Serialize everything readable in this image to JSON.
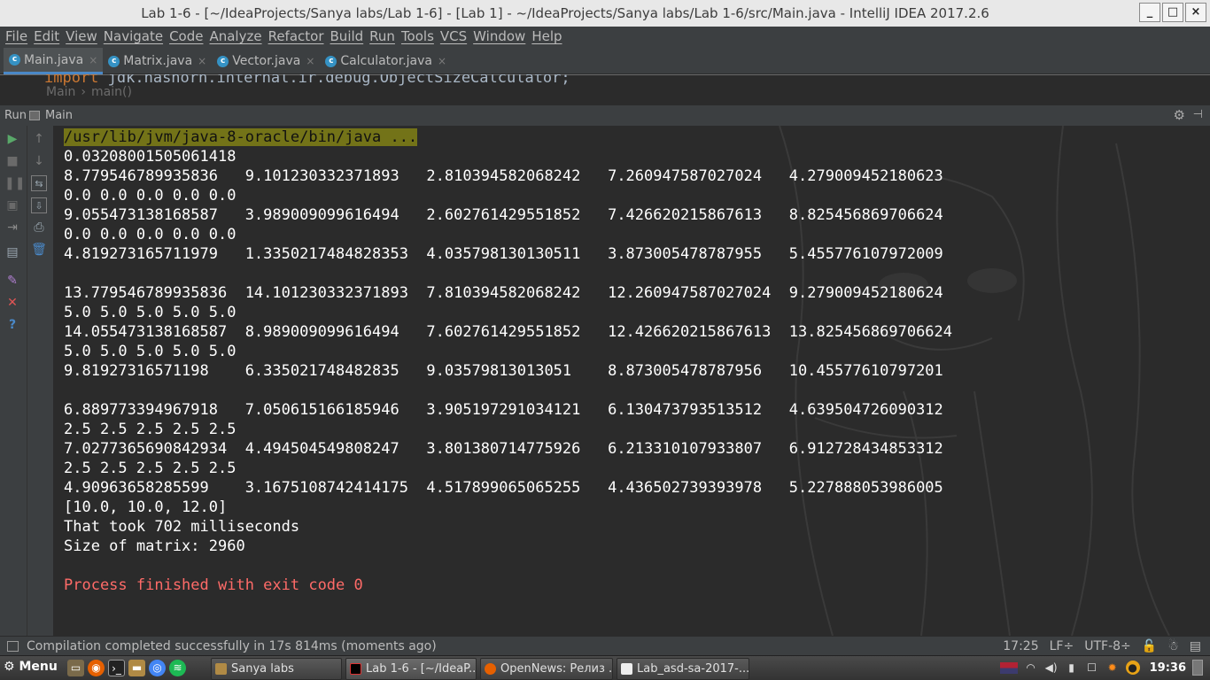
{
  "window": {
    "title": "Lab 1-6 - [~/IdeaProjects/Sanya labs/Lab 1-6] - [Lab 1] - ~/IdeaProjects/Sanya labs/Lab 1-6/src/Main.java - IntelliJ IDEA 2017.2.6",
    "minimize": "_",
    "maximize": "□",
    "close": "×"
  },
  "menu": [
    "File",
    "Edit",
    "View",
    "Navigate",
    "Code",
    "Analyze",
    "Refactor",
    "Build",
    "Run",
    "Tools",
    "VCS",
    "Window",
    "Help"
  ],
  "tabs": [
    {
      "label": "Main.java",
      "close": "×",
      "active": true
    },
    {
      "label": "Matrix.java",
      "close": "×",
      "active": false
    },
    {
      "label": "Vector.java",
      "close": "×",
      "active": false
    },
    {
      "label": "Calculator.java",
      "close": "×",
      "active": false
    }
  ],
  "editor": {
    "code_keyword": "import ",
    "code_package": "jdk.nashorn.internal.ir.debug.ObjectSizeCalculator;",
    "breadcrumb": [
      "Main",
      "main()"
    ]
  },
  "run_panel": {
    "label": "Run",
    "config": "Main"
  },
  "console": {
    "command": "/usr/lib/jvm/java-8-oracle/bin/java ...",
    "lines": [
      "0.03208001505061418",
      "8.779546789935836   9.101230332371893   2.810394582068242   7.260947587027024   4.279009452180623",
      "0.0 0.0 0.0 0.0 0.0",
      "9.055473138168587   3.989009099616494   2.602761429551852   7.426620215867613   8.825456869706624",
      "0.0 0.0 0.0 0.0 0.0",
      "4.819273165711979   1.3350217484828353  4.035798130130511   3.873005478787955   5.455776107972009",
      "",
      "13.779546789935836  14.101230332371893  7.810394582068242   12.260947587027024  9.279009452180624",
      "5.0 5.0 5.0 5.0 5.0",
      "14.055473138168587  8.989009099616494   7.602761429551852   12.426620215867613  13.825456869706624",
      "5.0 5.0 5.0 5.0 5.0",
      "9.81927316571198    6.335021748482835   9.03579813013051    8.873005478787956   10.45577610797201",
      "",
      "6.889773394967918   7.050615166185946   3.905197291034121   6.130473793513512   4.639504726090312",
      "2.5 2.5 2.5 2.5 2.5",
      "7.0277365690842934  4.494504549808247   3.801380714775926   6.213310107933807   6.912728434853312",
      "2.5 2.5 2.5 2.5 2.5",
      "4.90963658285599    3.1675108742414175  4.517899065065255   4.436502739393978   5.227888053986005",
      "[10.0, 10.0, 12.0]",
      "That took 702 milliseconds",
      "Size of matrix: 2960",
      ""
    ],
    "exit": "Process finished with exit code 0"
  },
  "status": {
    "message": "Compilation completed successfully in 17s 814ms (moments ago)",
    "position": "17:25",
    "line_sep": "LF÷",
    "encoding": "UTF-8÷"
  },
  "taskbar": {
    "start": "Menu",
    "windows": [
      {
        "label": "Sanya labs"
      },
      {
        "label": "Lab 1-6 - [~/IdeaP..."
      },
      {
        "label": "OpenNews: Релиз ..."
      },
      {
        "label": "Lab_asd-sa-2017-..."
      }
    ],
    "clock": "19:36"
  },
  "colors": {
    "accent": "#4a88c7",
    "console_bg": "#2b2b2b",
    "panel_bg": "#3c3f41",
    "exit_text": "#ff6b68",
    "cmd_highlight": "#737318"
  }
}
